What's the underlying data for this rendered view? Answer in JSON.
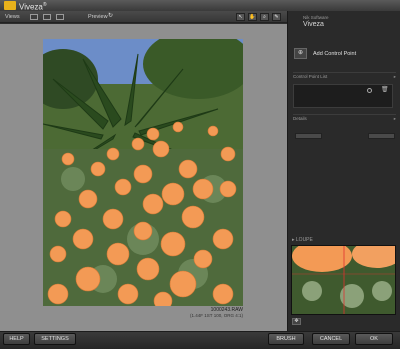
{
  "app": {
    "title": "Viveza",
    "trademark": "®"
  },
  "toolbar": {
    "views_label": "Views",
    "preview_label": "Preview"
  },
  "image": {
    "filename": "1000243.RAW",
    "info": "(1.44F 1ST 100, ORG 4:1)"
  },
  "panel": {
    "vendor": "Nik Software",
    "plugin_name": "Viveza",
    "add_control_point": "Add Control Point",
    "control_point_list": "Control Point List",
    "details": "Details",
    "loupe": "LOUPE"
  },
  "bottom": {
    "help": "HELP",
    "settings": "SETTINGS",
    "brush": "BRUSH",
    "cancel": "CANCEL",
    "ok": "OK"
  },
  "icons": {
    "logo": "nik-logo-icon",
    "preview": "preview-toggle-icon",
    "trash": "trash-icon",
    "circle": "control-point-circle-icon"
  },
  "colors": {
    "accent": "#e9b21b",
    "flower": "#f39a55",
    "canvas": "#8f8f8f"
  }
}
